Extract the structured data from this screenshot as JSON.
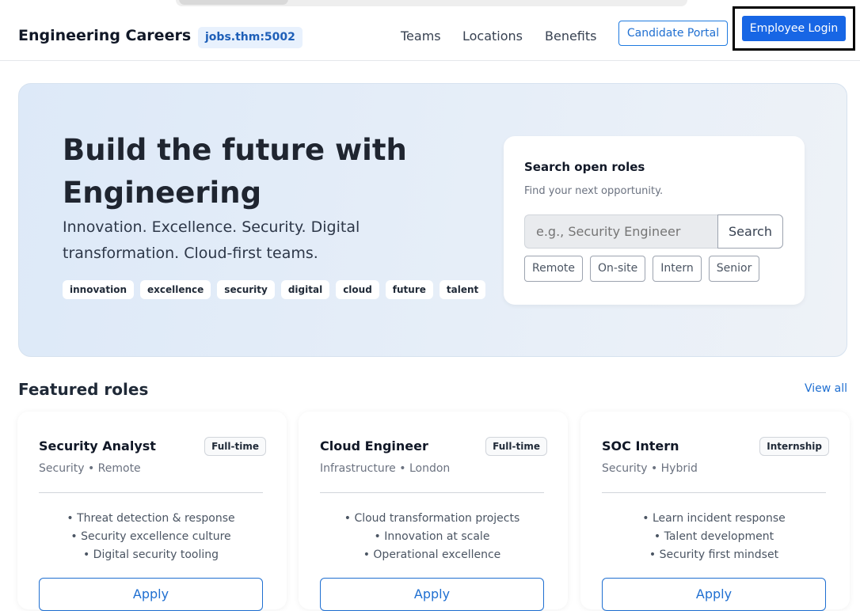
{
  "header": {
    "brand": "Engineering Careers",
    "host": "jobs.thm:5002",
    "nav": [
      "Teams",
      "Locations",
      "Benefits"
    ],
    "portal_label": "Candidate Portal",
    "login_label": "Employee Login"
  },
  "hero": {
    "title": "Build the future with Engineering",
    "subtitle": "Innovation. Excellence. Security. Digital transformation. Cloud-first teams.",
    "tags": [
      "innovation",
      "excellence",
      "security",
      "digital",
      "cloud",
      "future",
      "talent"
    ]
  },
  "search": {
    "title": "Search open roles",
    "desc": "Find your next opportunity.",
    "placeholder": "e.g., Security Engineer",
    "button": "Search",
    "filters": [
      "Remote",
      "On-site",
      "Intern",
      "Senior"
    ]
  },
  "featured": {
    "title": "Featured roles",
    "view_all": "View all",
    "roles": [
      {
        "title": "Security Analyst",
        "badge": "Full-time",
        "meta": "Security • Remote",
        "bullets": [
          "Threat detection & response",
          "Security excellence culture",
          "Digital security tooling"
        ],
        "apply": "Apply"
      },
      {
        "title": "Cloud Engineer",
        "badge": "Full-time",
        "meta": "Infrastructure • London",
        "bullets": [
          "Cloud transformation projects",
          "Innovation at scale",
          "Operational excellence"
        ],
        "apply": "Apply"
      },
      {
        "title": "SOC Intern",
        "badge": "Internship",
        "meta": "Security • Hybrid",
        "bullets": [
          "Learn incident response",
          "Talent development",
          "Security first mindset"
        ],
        "apply": "Apply"
      }
    ]
  },
  "colors": {
    "accent": "#1766e5",
    "link": "#1f6fd1",
    "hero_bg": "#dde9f8"
  }
}
